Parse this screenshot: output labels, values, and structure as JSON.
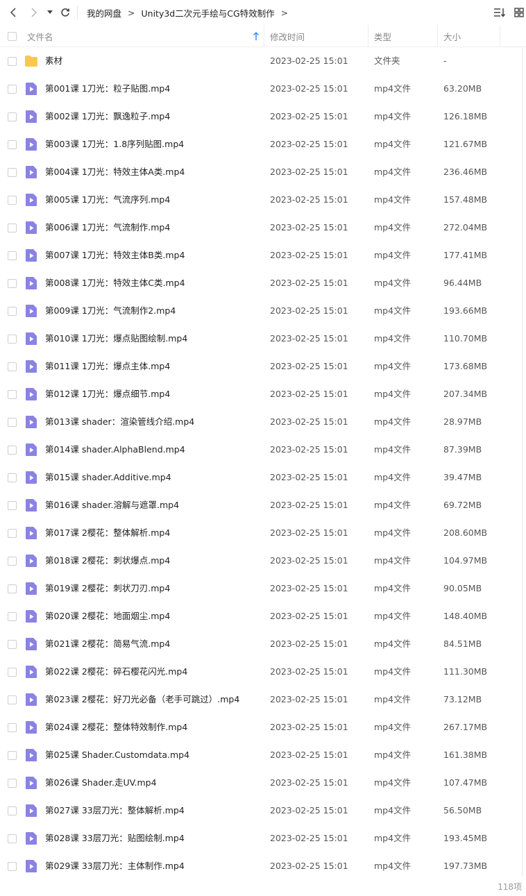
{
  "toolbar": {
    "back_icon": "chevron-left-icon",
    "forward_icon": "chevron-right-icon",
    "history_icon": "caret-down-icon",
    "refresh_icon": "refresh-icon",
    "sort_icon": "sort-list-icon",
    "view_icon": "grid-view-icon"
  },
  "breadcrumb": {
    "items": [
      "我的网盘",
      "Unity3d二次元手绘与CG特效制作"
    ],
    "separator": ">"
  },
  "header": {
    "name": "文件名",
    "mtime": "修改时间",
    "type": "类型",
    "size": "大小"
  },
  "colors": {
    "folder": "#f8c94a",
    "video": "#8b82e6",
    "header_text": "#888888"
  },
  "files": [
    {
      "name": "素材",
      "mtime": "2023-02-25 15:01",
      "type": "文件夹",
      "size": "-",
      "icon": "folder-icon"
    },
    {
      "name": "第001课 1刀光：粒子贴图.mp4",
      "mtime": "2023-02-25 15:01",
      "type": "mp4文件",
      "size": "63.20MB",
      "icon": "video-file-icon"
    },
    {
      "name": "第002课 1刀光：飘逸粒子.mp4",
      "mtime": "2023-02-25 15:01",
      "type": "mp4文件",
      "size": "126.18MB",
      "icon": "video-file-icon"
    },
    {
      "name": "第003课 1刀光：1.8序列贴图.mp4",
      "mtime": "2023-02-25 15:01",
      "type": "mp4文件",
      "size": "121.67MB",
      "icon": "video-file-icon"
    },
    {
      "name": "第004课 1刀光：特效主体A类.mp4",
      "mtime": "2023-02-25 15:01",
      "type": "mp4文件",
      "size": "236.46MB",
      "icon": "video-file-icon"
    },
    {
      "name": "第005课 1刀光：气流序列.mp4",
      "mtime": "2023-02-25 15:01",
      "type": "mp4文件",
      "size": "157.48MB",
      "icon": "video-file-icon"
    },
    {
      "name": "第006课 1刀光：气流制作.mp4",
      "mtime": "2023-02-25 15:01",
      "type": "mp4文件",
      "size": "272.04MB",
      "icon": "video-file-icon"
    },
    {
      "name": "第007课 1刀光：特效主体B类.mp4",
      "mtime": "2023-02-25 15:01",
      "type": "mp4文件",
      "size": "177.41MB",
      "icon": "video-file-icon"
    },
    {
      "name": "第008课 1刀光：特效主体C类.mp4",
      "mtime": "2023-02-25 15:01",
      "type": "mp4文件",
      "size": "96.44MB",
      "icon": "video-file-icon"
    },
    {
      "name": "第009课 1刀光：气流制作2.mp4",
      "mtime": "2023-02-25 15:01",
      "type": "mp4文件",
      "size": "193.66MB",
      "icon": "video-file-icon"
    },
    {
      "name": "第010课 1刀光：爆点贴图绘制.mp4",
      "mtime": "2023-02-25 15:01",
      "type": "mp4文件",
      "size": "110.70MB",
      "icon": "video-file-icon"
    },
    {
      "name": "第011课 1刀光：爆点主体.mp4",
      "mtime": "2023-02-25 15:01",
      "type": "mp4文件",
      "size": "173.68MB",
      "icon": "video-file-icon"
    },
    {
      "name": "第012课 1刀光：爆点细节.mp4",
      "mtime": "2023-02-25 15:01",
      "type": "mp4文件",
      "size": "207.34MB",
      "icon": "video-file-icon"
    },
    {
      "name": "第013课 shader：渲染管线介绍.mp4",
      "mtime": "2023-02-25 15:01",
      "type": "mp4文件",
      "size": "28.97MB",
      "icon": "video-file-icon"
    },
    {
      "name": "第014课 shader.AlphaBlend.mp4",
      "mtime": "2023-02-25 15:01",
      "type": "mp4文件",
      "size": "87.39MB",
      "icon": "video-file-icon"
    },
    {
      "name": "第015课 shader.Additive.mp4",
      "mtime": "2023-02-25 15:01",
      "type": "mp4文件",
      "size": "39.47MB",
      "icon": "video-file-icon"
    },
    {
      "name": "第016课 shader.溶解与遮罩.mp4",
      "mtime": "2023-02-25 15:01",
      "type": "mp4文件",
      "size": "69.72MB",
      "icon": "video-file-icon"
    },
    {
      "name": "第017课 2樱花：整体解析.mp4",
      "mtime": "2023-02-25 15:01",
      "type": "mp4文件",
      "size": "208.60MB",
      "icon": "video-file-icon"
    },
    {
      "name": "第018课 2樱花：刺状爆点.mp4",
      "mtime": "2023-02-25 15:01",
      "type": "mp4文件",
      "size": "104.97MB",
      "icon": "video-file-icon"
    },
    {
      "name": "第019课 2樱花：刺状刀刃.mp4",
      "mtime": "2023-02-25 15:01",
      "type": "mp4文件",
      "size": "90.05MB",
      "icon": "video-file-icon"
    },
    {
      "name": "第020课 2樱花：地面烟尘.mp4",
      "mtime": "2023-02-25 15:01",
      "type": "mp4文件",
      "size": "148.40MB",
      "icon": "video-file-icon"
    },
    {
      "name": "第021课 2樱花：简易气流.mp4",
      "mtime": "2023-02-25 15:01",
      "type": "mp4文件",
      "size": "84.51MB",
      "icon": "video-file-icon"
    },
    {
      "name": "第022课 2樱花：碎石樱花闪光.mp4",
      "mtime": "2023-02-25 15:01",
      "type": "mp4文件",
      "size": "111.30MB",
      "icon": "video-file-icon"
    },
    {
      "name": "第023课 2樱花：好刀光必备（老手可跳过）.mp4",
      "mtime": "2023-02-25 15:01",
      "type": "mp4文件",
      "size": "73.12MB",
      "icon": "video-file-icon"
    },
    {
      "name": "第024课 2樱花：整体特效制作.mp4",
      "mtime": "2023-02-25 15:01",
      "type": "mp4文件",
      "size": "267.17MB",
      "icon": "video-file-icon"
    },
    {
      "name": "第025课 Shader.Customdata.mp4",
      "mtime": "2023-02-25 15:01",
      "type": "mp4文件",
      "size": "161.38MB",
      "icon": "video-file-icon"
    },
    {
      "name": "第026课 Shader.走UV.mp4",
      "mtime": "2023-02-25 15:01",
      "type": "mp4文件",
      "size": "107.47MB",
      "icon": "video-file-icon"
    },
    {
      "name": "第027课 33层刀光：整体解析.mp4",
      "mtime": "2023-02-25 15:01",
      "type": "mp4文件",
      "size": "56.50MB",
      "icon": "video-file-icon"
    },
    {
      "name": "第028课 33层刀光：贴图绘制.mp4",
      "mtime": "2023-02-25 15:01",
      "type": "mp4文件",
      "size": "193.45MB",
      "icon": "video-file-icon"
    },
    {
      "name": "第029课 33层刀光：主体制作.mp4",
      "mtime": "2023-02-25 15:01",
      "type": "mp4文件",
      "size": "197.73MB",
      "icon": "video-file-icon"
    }
  ],
  "footer": {
    "count": "118项"
  }
}
